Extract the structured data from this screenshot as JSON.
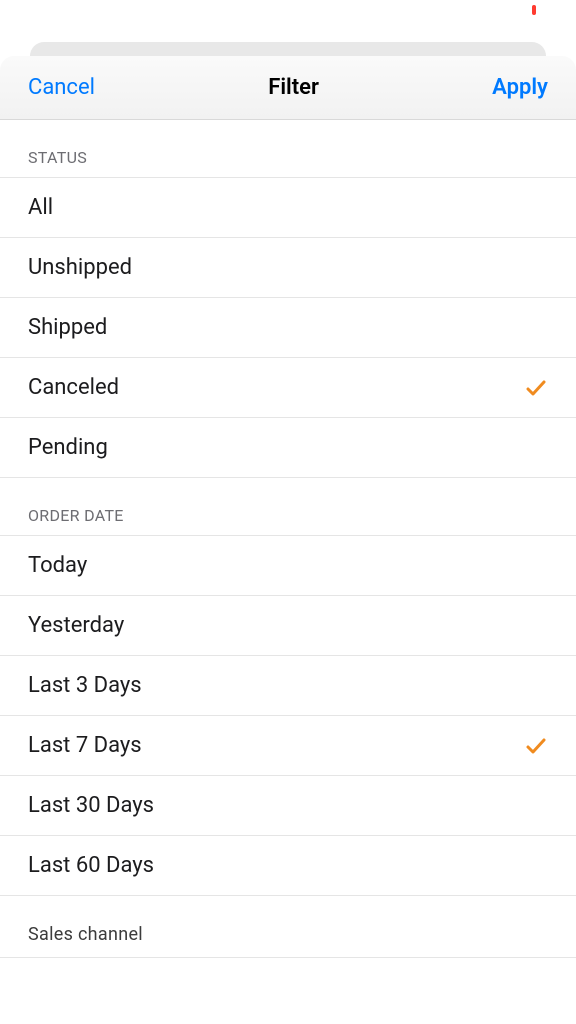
{
  "header": {
    "cancel_label": "Cancel",
    "title": "Filter",
    "apply_label": "Apply"
  },
  "sections": {
    "status": {
      "title": "STATUS",
      "options": [
        {
          "label": "All",
          "selected": false
        },
        {
          "label": "Unshipped",
          "selected": false
        },
        {
          "label": "Shipped",
          "selected": false
        },
        {
          "label": "Canceled",
          "selected": true
        },
        {
          "label": "Pending",
          "selected": false
        }
      ]
    },
    "order_date": {
      "title": "ORDER DATE",
      "options": [
        {
          "label": "Today",
          "selected": false
        },
        {
          "label": "Yesterday",
          "selected": false
        },
        {
          "label": "Last 3 Days",
          "selected": false
        },
        {
          "label": "Last 7 Days",
          "selected": true
        },
        {
          "label": "Last 30 Days",
          "selected": false
        },
        {
          "label": "Last 60 Days",
          "selected": false
        }
      ]
    },
    "sales_channel": {
      "title": "Sales channel"
    }
  },
  "colors": {
    "accent": "#007aff",
    "checkmark": "#f08b1f"
  }
}
